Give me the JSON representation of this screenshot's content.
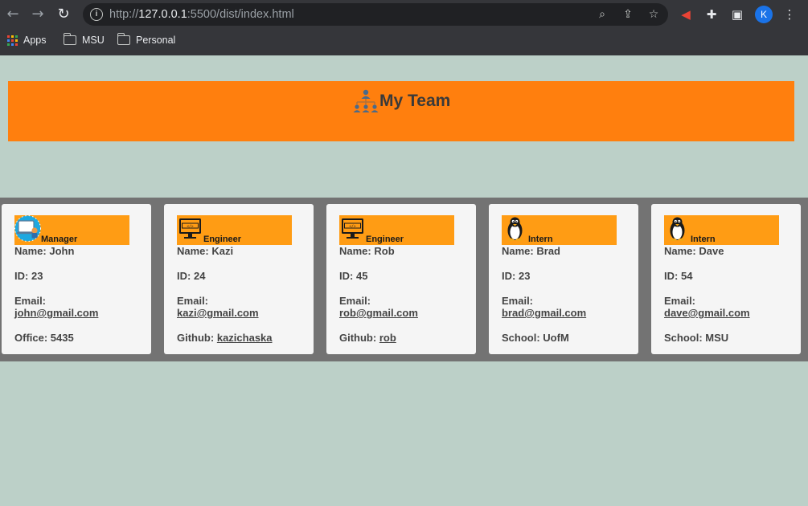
{
  "browser": {
    "url_prefix": "http://",
    "url_host": "127.0.0.1",
    "url_path": ":5500/dist/index.html",
    "profile_initial": "K",
    "bookmarks": [
      "Apps",
      "MSU",
      "Personal"
    ]
  },
  "header": {
    "title": "My Team"
  },
  "labels": {
    "name": "Name:",
    "id": "ID:",
    "email": "Email:",
    "office": "Office:",
    "github": "Github:",
    "school": "School:"
  },
  "employees": [
    {
      "role": "Manager",
      "name": "John",
      "id": "23",
      "email": "john@gmail.com",
      "extra_label": "Office:",
      "extra_value": "5435",
      "extra_is_link": false
    },
    {
      "role": "Engineer",
      "name": "Kazi",
      "id": "24",
      "email": "kazi@gmail.com",
      "extra_label": "Github:",
      "extra_value": "kazichaska",
      "extra_is_link": true
    },
    {
      "role": "Engineer",
      "name": "Rob",
      "id": "45",
      "email": "rob@gmail.com",
      "extra_label": "Github:",
      "extra_value": "rob",
      "extra_is_link": true
    },
    {
      "role": "Intern",
      "name": "Brad",
      "id": "23",
      "email": "brad@gmail.com",
      "extra_label": "School:",
      "extra_value": "UofM",
      "extra_is_link": false
    },
    {
      "role": "Intern",
      "name": "Dave",
      "id": "54",
      "email": "dave@gmail.com",
      "extra_label": "School:",
      "extra_value": "MSU",
      "extra_is_link": false
    }
  ],
  "colors": {
    "page_bg": "#bcd0c8",
    "banner": "#ff7f0e",
    "role_band": "#ff9c14",
    "cards_strip": "#737373",
    "card_bg": "#f5f5f5"
  }
}
